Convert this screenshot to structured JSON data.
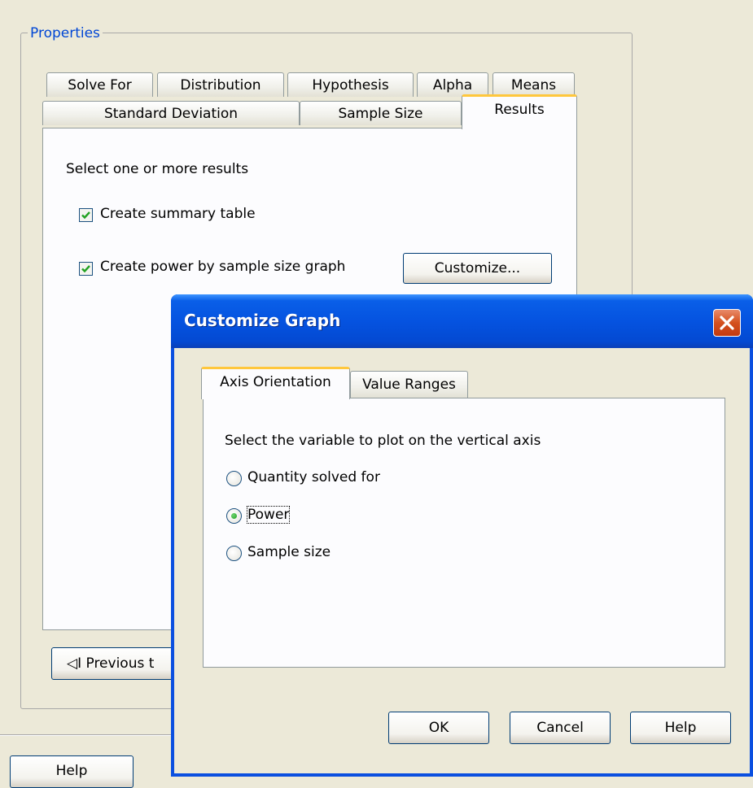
{
  "properties": {
    "legend": "Properties",
    "tabs_row1": [
      "Solve For",
      "Distribution",
      "Hypothesis",
      "Alpha",
      "Means"
    ],
    "tabs_row2": [
      "Standard Deviation",
      "Sample Size",
      "Results"
    ],
    "selected_tab": "Results",
    "results_panel": {
      "prompt": "Select one or more results",
      "summary_label": "Create summary table",
      "summary_checked": true,
      "graph_label": "Create power by sample size graph",
      "graph_checked": true,
      "customize_label": "Customize..."
    },
    "previous_button_label": "◁I Previous t",
    "help_button_label": "Help"
  },
  "dialog": {
    "title": "Customize Graph",
    "tabs": [
      "Axis Orientation",
      "Value Ranges"
    ],
    "selected_tab": "Axis Orientation",
    "prompt": "Select the variable to plot on the vertical axis",
    "options": [
      "Quantity solved for",
      "Power",
      "Sample size"
    ],
    "selected_option": "Power",
    "ok_label": "OK",
    "cancel_label": "Cancel",
    "help_label": "Help"
  },
  "colors": {
    "window_bg": "#ECE9D8",
    "legend_text": "#0046D5",
    "tab_highlight": "#FFC73C",
    "titlebar": "#0553E0",
    "check_mark": "#21A121"
  }
}
